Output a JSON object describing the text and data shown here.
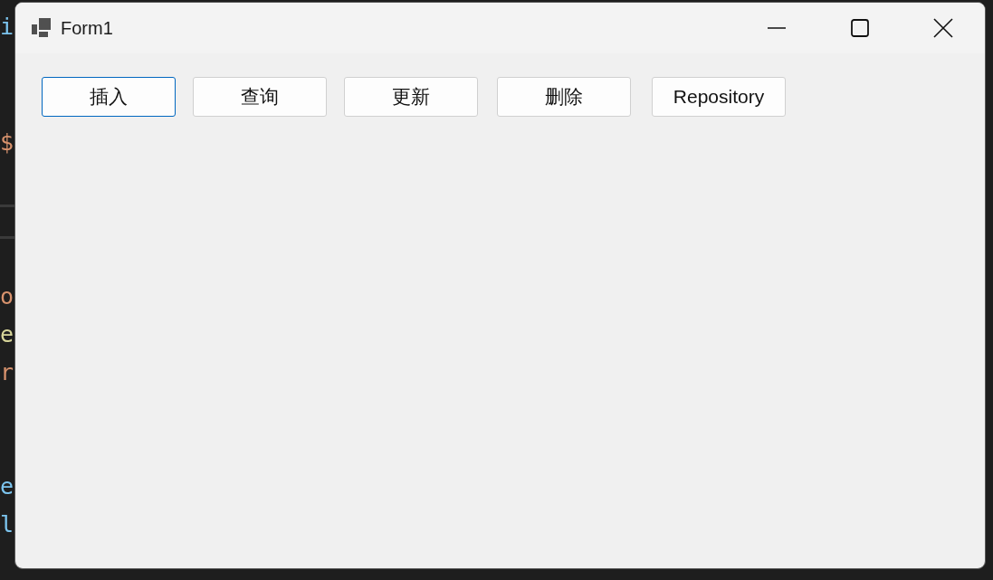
{
  "editor": {
    "lines": [
      {
        "text": "i",
        "color": "#7cc4ee"
      },
      {
        "text": "$",
        "color": "#d7926d"
      },
      {
        "text": "o",
        "color": "#d7926d"
      },
      {
        "text": "e",
        "color": "#d8d69a"
      },
      {
        "text": "r",
        "color": "#d7926d"
      },
      {
        "text": "e",
        "color": "#7cc4ee"
      },
      {
        "text": "l",
        "color": "#7cc4ee"
      }
    ]
  },
  "window": {
    "title": "Form1"
  },
  "buttons": [
    {
      "label": "插入",
      "focused": true
    },
    {
      "label": "查询",
      "focused": false
    },
    {
      "label": "更新",
      "focused": false
    },
    {
      "label": "删除",
      "focused": false
    },
    {
      "label": "Repository",
      "focused": false
    }
  ]
}
